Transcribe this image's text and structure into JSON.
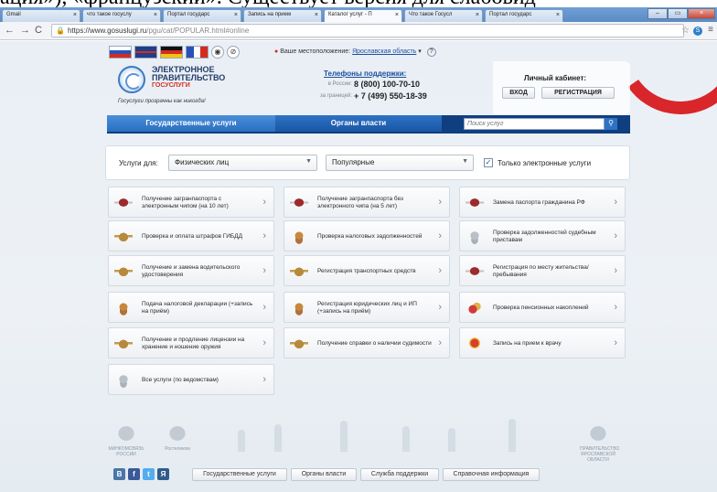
{
  "caption": "ация»), «французский». Существует версия для слабовид",
  "browser": {
    "tabs": [
      {
        "title": "Gmail",
        "active": false
      },
      {
        "title": "что такое госуслу",
        "active": false
      },
      {
        "title": "Портал государс",
        "active": false
      },
      {
        "title": "Запись на прием",
        "active": false
      },
      {
        "title": "Каталог услуг - П",
        "active": true
      },
      {
        "title": "Что такое Госусл",
        "active": false
      },
      {
        "title": "Портал государс",
        "active": false
      }
    ],
    "url_host": "https://www.gosuslugi.ru",
    "url_path": "/pgu/cat/POPULAR.html#online"
  },
  "header": {
    "location_label": "Ваше местоположение:",
    "location_value": "Ярославская область",
    "logo_line1": "ЭЛЕКТРОННОЕ",
    "logo_line2": "ПРАВИТЕЛЬСТВО",
    "logo_sub": "ГОСУСЛУГИ",
    "slogan": "Госуслуги прозрачны как никогда!",
    "support_title": "Телефоны поддержки:",
    "support_rows": [
      {
        "label": "в России:",
        "number": "8 (800) 100-70-10"
      },
      {
        "label": "за границей:",
        "number": "+ 7 (499) 550-18-39"
      }
    ],
    "cabinet_title": "Личный кабинет:",
    "login_label": "ВХОД",
    "register_label": "РЕГИСТРАЦИЯ"
  },
  "nav": {
    "services": "Государственные услуги",
    "authorities": "Органы власти",
    "search_placeholder": "Поиск услуг"
  },
  "filter": {
    "label": "Услуги для:",
    "audience": "Физических лиц",
    "sort": "Популярные",
    "electronic_only": "Только электронные услуги"
  },
  "services": [
    {
      "label": "Получение загранпаспорта с электронным чипом (на 10 лет)",
      "icon": "passport-icon"
    },
    {
      "label": "Получение загранпаспорта без электронного чипа (на 5 лет)",
      "icon": "passport-icon"
    },
    {
      "label": "Замена паспорта гражданина РФ",
      "icon": "passport-icon"
    },
    {
      "label": "Проверка и оплата штрафов ГИБДД",
      "icon": "eagle-icon"
    },
    {
      "label": "Проверка налоговых задолженностей",
      "icon": "coat-of-arms-icon"
    },
    {
      "label": "Проверка задолженностей судебным приставам",
      "icon": "coat-of-arms-gray-icon"
    },
    {
      "label": "Получение и замена водительского удостоверения",
      "icon": "eagle-icon"
    },
    {
      "label": "Регистрация транспортных средств",
      "icon": "eagle-icon"
    },
    {
      "label": "Регистрация по месту жительства/пребывания",
      "icon": "passport-icon"
    },
    {
      "label": "Подача налоговой декларации (+запись на приём)",
      "icon": "coat-of-arms-icon"
    },
    {
      "label": "Регистрация юридических лиц и ИП (+запись на приём)",
      "icon": "coat-of-arms-icon"
    },
    {
      "label": "Проверка пенсионных накоплений",
      "icon": "coins-icon"
    },
    {
      "label": "Получение и продление лицензии на хранение и ношение оружия",
      "icon": "eagle-icon"
    },
    {
      "label": "Получение справки о наличии судимости",
      "icon": "eagle-icon"
    },
    {
      "label": "Запись на прием к врачу",
      "icon": "health-emblem-icon"
    },
    {
      "label": "Все услуги (по ведомствам)",
      "icon": "coat-of-arms-gray-icon"
    }
  ],
  "footer": {
    "logo_left1": "МИНКОМСВЯЗЬ РОССИИ",
    "logo_left2": "Ростелеком",
    "logo_right": "ПРАВИТЕЛЬСТВО ЯРОСЛАВСКОЙ ОБЛАСТИ",
    "social": [
      "B",
      "f",
      "t",
      "Я"
    ],
    "links": [
      "Государственные услуги",
      "Органы власти",
      "Служба поддержки",
      "Справочная информация"
    ]
  }
}
